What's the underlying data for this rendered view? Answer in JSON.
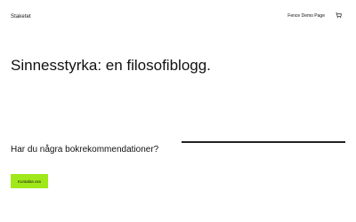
{
  "header": {
    "site_title": "Staketet",
    "nav_link": "Fence Demo Page",
    "cart_icon": "cart-icon"
  },
  "hero": {
    "heading": "Sinnesstyrka: en filosofiblogg."
  },
  "cta": {
    "question": "Har du några bokrekommendationer?",
    "button_label": "Kontakta oss",
    "button_color": "#a0e81a"
  }
}
